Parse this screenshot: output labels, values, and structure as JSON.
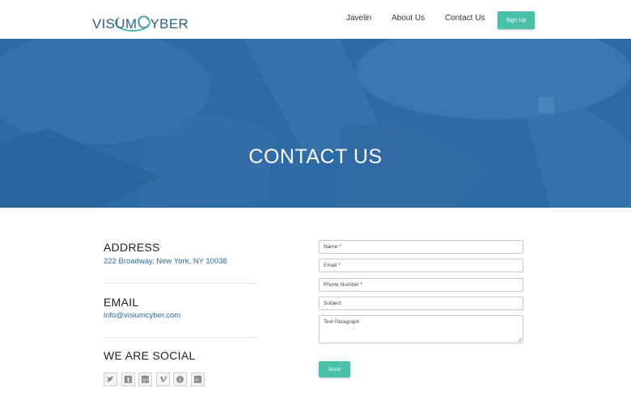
{
  "header": {
    "logo": {
      "part1": "VISUM",
      "part2": "C",
      "part3": "YBER"
    },
    "nav": [
      {
        "label": "Javelin"
      },
      {
        "label": "About Us"
      },
      {
        "label": "Contact Us"
      }
    ],
    "signup_label": "Sign Up"
  },
  "hero": {
    "title": "CONTACT US",
    "overlay_color": "#2c6aa8"
  },
  "info": {
    "address_title": "ADDRESS",
    "address_value": "222 Broadway, New York, NY 10038",
    "email_title": "EMAIL",
    "email_value": "info@visiumcyber.com",
    "social_title": "WE ARE SOCIAL",
    "social_icons": [
      "twitter-icon",
      "tumblr-icon",
      "google-plus-icon",
      "vimeo-icon",
      "skype-icon",
      "linkedin-icon"
    ]
  },
  "form": {
    "name_placeholder": "Name *",
    "email_placeholder": "Email *",
    "phone_placeholder": "Phone Number *",
    "subject_placeholder": "Subject",
    "message_placeholder": "Text Paragraph",
    "send_label": "Send"
  },
  "colors": {
    "accent": "#48c1a8",
    "link": "#2d6aa0",
    "hero": "#2c6aa8"
  }
}
